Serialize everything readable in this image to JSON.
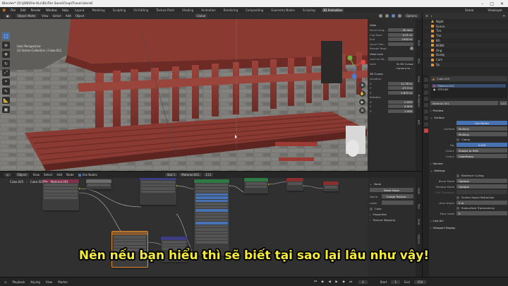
{
  "window": {
    "title": "Blender* [D:\\JOB\\File-ALL\\BL\\File Save\\Chap\\Travel.blend]",
    "controls": [
      "–",
      "□",
      "✕"
    ]
  },
  "menubar": {
    "menus": [
      "File",
      "Edit",
      "Render",
      "Window",
      "Help"
    ],
    "workspaces": [
      "Layout",
      "Modeling",
      "Sculpting",
      "UV Editing",
      "Texture Paint",
      "Shading",
      "Animation",
      "Rendering",
      "Compositing",
      "Geometry Nodes",
      "Scripting",
      "3D Animation"
    ],
    "active_workspace": "3D Animation",
    "scene": "Scene",
    "view_layer": "ViewLayer"
  },
  "viewport": {
    "mode": "Object Mode",
    "menus": [
      "View",
      "Select",
      "Add",
      "Object"
    ],
    "orientation": "Global",
    "options_label": "Options",
    "overlay_line1": "User Perspective",
    "overlay_line2": "(2) Scene Collection | Cube.011",
    "tools": [
      "select",
      "cursor",
      "move",
      "rotate",
      "scale",
      "transform",
      "annotate",
      "measure",
      "add-cube"
    ],
    "npanel": {
      "view_header": "View",
      "focal_length_label": "Focal Leng...",
      "focal_length": "50 mm",
      "clip_start_label": "Clip Start",
      "clip_start": "0.01 m",
      "clip_end_label": "End",
      "clip_end": "1000 m",
      "local_camera_label": "Local Cam...",
      "render_region_label": "Render Regi...",
      "view_lock_header": "View Lock",
      "lock_to_object_label": "Lock to Ob...",
      "lock_label": "Lock",
      "to_3d_cursor": "To 3D Cursor",
      "camera_to": "Camera to ...",
      "cursor_header": "3D Cursor",
      "location_label": "Location",
      "loc_x": "11.76 m",
      "loc_y": "-27.3 m",
      "loc_z": "2.672 m",
      "rotation_label": "Rotation",
      "rot_x": "0.000",
      "rot_y": "0.000",
      "rot_z": "1.000"
    },
    "side_tabs": [
      "Item",
      "Tool",
      "View",
      "Animation",
      "Edit"
    ]
  },
  "outliner": {
    "items": [
      {
        "name": "Night"
      },
      {
        "name": "Scene"
      },
      {
        "name": "Tiro"
      },
      {
        "name": "Tno"
      },
      {
        "name": "BG"
      },
      {
        "name": "BGNA"
      },
      {
        "name": "Ong"
      },
      {
        "name": "Dusky"
      },
      {
        "name": "Cam"
      },
      {
        "name": "Sp"
      }
    ]
  },
  "properties": {
    "object_name": "Cube.025",
    "material_slots": [
      "Material.001",
      "STROKE"
    ],
    "material_name": "Material.001",
    "user_count": "113",
    "preview_label": "Preview",
    "surface_header": "Surface",
    "use_nodes_label": "Use Nodes",
    "surface_label": "Surface",
    "surface_value": "Multiply",
    "blend_value": "Multiply",
    "clamp_label": "Clamp",
    "fac_label": "Fac",
    "fac_value": "0.500",
    "color1_label": "Color1",
    "color1_value": "Shader to RGB",
    "color2_label": "Color2",
    "color2_value": "ColorRamp",
    "volume_label": "Volume",
    "settings_label": "Settings",
    "backface_label": "Backface Culling",
    "blend_mode_label": "Blend Mode",
    "blend_mode_value": "Opaque",
    "shadow_mode_label": "Shadow Mode",
    "shadow_mode_value": "Opaque",
    "clip_threshold_label": "Clip Threshold",
    "screen_refraction_label": "Screen Space Refraction",
    "refraction_depth_label": "ction Depth",
    "refraction_depth_value": "0 m",
    "subsurface_label": "Subsurface Translucency",
    "pass_index_label": "Pass Index",
    "pass_index_value": "0",
    "line_art_label": "Line Art",
    "viewport_display_label": "Viewport Display"
  },
  "node_editor": {
    "type": "Object",
    "menus": [
      "View",
      "Select",
      "Add",
      "Node"
    ],
    "use_nodes_label": "Use Nodes",
    "slot_label": "Slot 1",
    "material_name": "Material.001",
    "user_count": "113",
    "breadcrumb": [
      "Cube.025",
      "Cube.025",
      "Material.001"
    ],
    "side": {
      "node_header": "Node",
      "reset_label": "Reset Node",
      "name_label": "Name",
      "name_value": "Image Texture...",
      "label_label": "Label",
      "color_label": "Color",
      "properties_label": "Properties",
      "texture_mapping_label": "Texture Mapping"
    },
    "side_tabs": [
      "Node",
      "Tool",
      "View",
      "Options",
      "Group"
    ]
  },
  "timeline": {
    "menus": [
      "Playback",
      "Keying",
      "View",
      "Marker"
    ],
    "current_frame": "2",
    "start_label": "Start",
    "start": "1",
    "end_label": "End",
    "end": "250"
  },
  "subtitle": "Nên nếu bạn hiểu thì sẽ biết tại sao lại lâu như vậy!",
  "colors": {
    "subtitle": "#f3ea3a",
    "accent_blue": "#4772b3",
    "wood_red": "#8e3a34",
    "active_tab_red": "#c8453d"
  }
}
